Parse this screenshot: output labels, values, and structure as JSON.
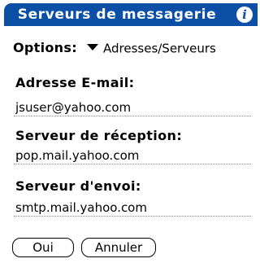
{
  "window": {
    "title": "Serveurs de messagerie",
    "info_icon": "info-icon",
    "accent_color": "#0b4fa6"
  },
  "options": {
    "label": "Options:",
    "selected": "Adresses/Serveurs"
  },
  "fields": {
    "email": {
      "label": "Adresse E-mail:",
      "value": "jsuser@yahoo.com"
    },
    "incoming": {
      "label": "Serveur de réception:",
      "value": "pop.mail.yahoo.com"
    },
    "outgoing": {
      "label": "Serveur d'envoi:",
      "value": "smtp.mail.yahoo.com"
    }
  },
  "buttons": {
    "ok": "Oui",
    "cancel": "Annuler"
  }
}
